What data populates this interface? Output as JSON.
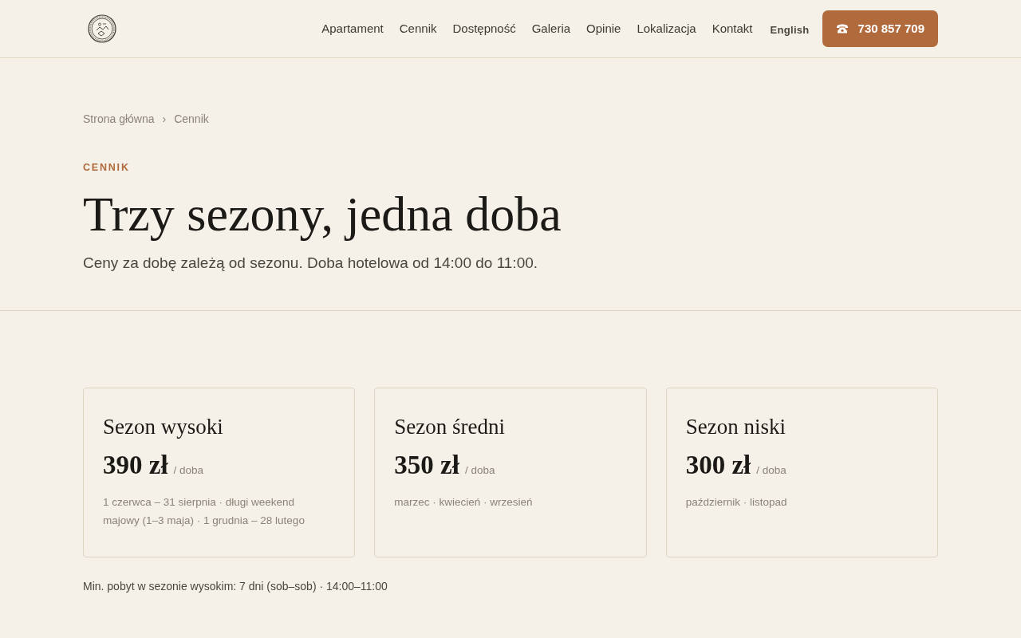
{
  "header": {
    "nav": [
      {
        "label": "Apartament"
      },
      {
        "label": "Cennik"
      },
      {
        "label": "Dostępność"
      },
      {
        "label": "Galeria"
      },
      {
        "label": "Opinie"
      },
      {
        "label": "Lokalizacja"
      },
      {
        "label": "Kontakt"
      }
    ],
    "language": "English",
    "phone_button": "730 857 709"
  },
  "breadcrumb": [
    {
      "label": "Strona główna"
    },
    {
      "label": "Cennik"
    }
  ],
  "breadcrumb_separator": "›",
  "hero": {
    "eyebrow": "CENNIK",
    "title": "Trzy sezony, jedna doba",
    "subtitle": "Ceny za dobę zależą od sezonu. Doba hotelowa od 14:00 do 11:00."
  },
  "seasons": [
    {
      "name": "Sezon wysoki",
      "price": "390 zł",
      "unit": "/ doba",
      "dates": "1 czerwca – 31 sierpnia · długi weekend majowy (1–3 maja) · 1 grudnia – 28 lutego"
    },
    {
      "name": "Sezon średni",
      "price": "350 zł",
      "unit": "/ doba",
      "dates": "marzec · kwiecień · wrzesień"
    },
    {
      "name": "Sezon niski",
      "price": "300 zł",
      "unit": "/ doba",
      "dates": "październik · listopad"
    }
  ],
  "note": "Min. pobyt w sezonie wysokim: 7 dni (sob–sob) · 14:00–11:00"
}
